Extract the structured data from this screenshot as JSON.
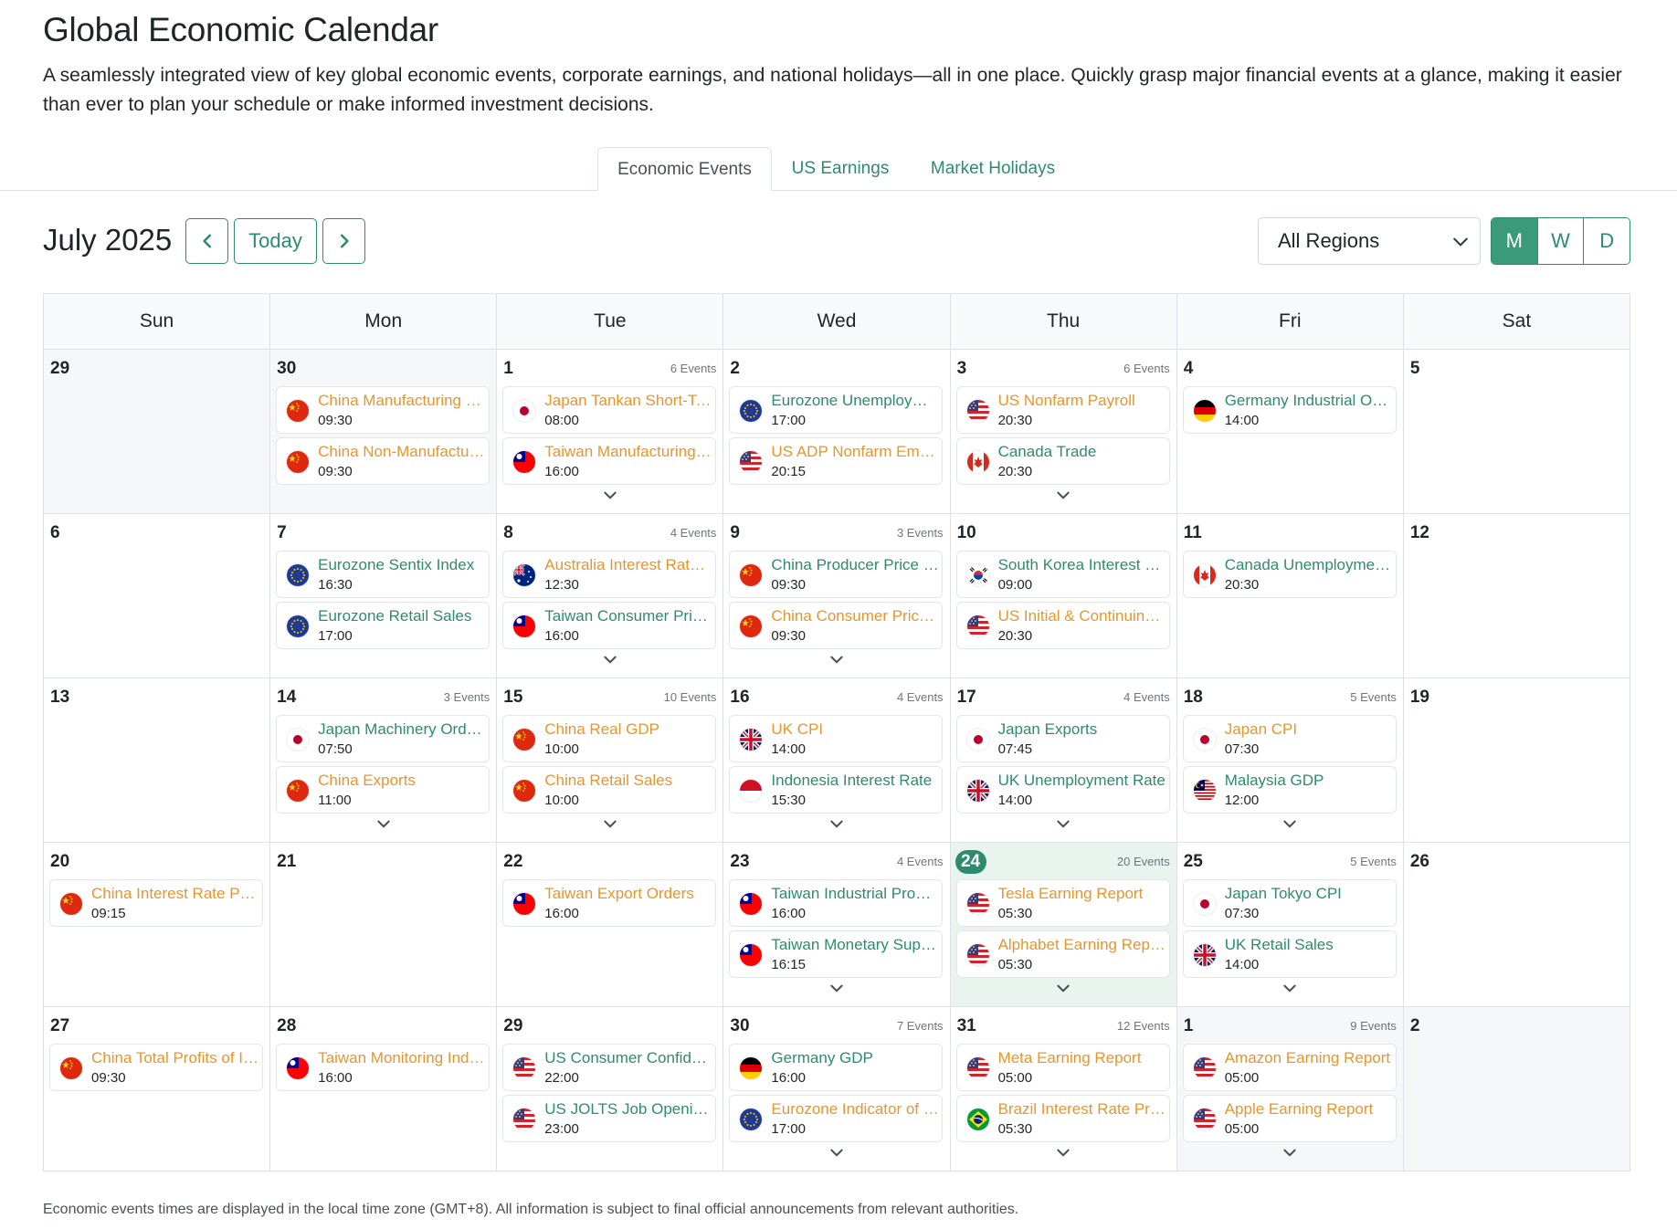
{
  "header": {
    "title": "Global Economic Calendar",
    "description": "A seamlessly integrated view of key global economic events, corporate earnings, and national holidays—all in one place. Quickly grasp major financial events at a glance, making it easier than ever to plan your schedule or make informed investment decisions."
  },
  "tabs": [
    {
      "label": "Economic Events",
      "active": true
    },
    {
      "label": "US Earnings",
      "active": false
    },
    {
      "label": "Market Holidays",
      "active": false
    }
  ],
  "toolbar": {
    "month": "July 2025",
    "today_label": "Today",
    "region": "All Regions",
    "views": [
      {
        "label": "M",
        "active": true
      },
      {
        "label": "W",
        "active": false
      },
      {
        "label": "D",
        "active": false
      }
    ]
  },
  "calendar": {
    "weekdays": [
      "Sun",
      "Mon",
      "Tue",
      "Wed",
      "Thu",
      "Fri",
      "Sat"
    ],
    "weeks": [
      [
        {
          "day": "29",
          "other": true,
          "count": "",
          "events": [],
          "more": false
        },
        {
          "day": "30",
          "other": true,
          "count": "",
          "more": false,
          "events": [
            {
              "name": "China Manufacturing PMI",
              "time": "09:30",
              "flag": "cn",
              "importance": "high"
            },
            {
              "name": "China Non-Manufacturing PMI",
              "time": "09:30",
              "flag": "cn",
              "importance": "high"
            }
          ]
        },
        {
          "day": "1",
          "other": false,
          "count": "6 Events",
          "more": true,
          "events": [
            {
              "name": "Japan Tankan Short-Term",
              "time": "08:00",
              "flag": "jp",
              "importance": "high"
            },
            {
              "name": "Taiwan Manufacturing PMI",
              "time": "16:00",
              "flag": "tw",
              "importance": "high"
            }
          ]
        },
        {
          "day": "2",
          "other": false,
          "count": "",
          "more": false,
          "events": [
            {
              "name": "Eurozone Unemployment Rate",
              "time": "17:00",
              "flag": "eu",
              "importance": "medium"
            },
            {
              "name": "US ADP Nonfarm Employment",
              "time": "20:15",
              "flag": "us",
              "importance": "high"
            }
          ]
        },
        {
          "day": "3",
          "other": false,
          "count": "6 Events",
          "more": true,
          "events": [
            {
              "name": "US Nonfarm Payroll",
              "time": "20:30",
              "flag": "us",
              "importance": "high"
            },
            {
              "name": "Canada Trade",
              "time": "20:30",
              "flag": "ca",
              "importance": "medium"
            }
          ]
        },
        {
          "day": "4",
          "other": false,
          "count": "",
          "more": false,
          "events": [
            {
              "name": "Germany Industrial Orders",
              "time": "14:00",
              "flag": "de",
              "importance": "medium"
            }
          ]
        },
        {
          "day": "5",
          "other": false,
          "count": "",
          "events": [],
          "more": false
        }
      ],
      [
        {
          "day": "6",
          "other": false,
          "count": "",
          "events": [],
          "more": false
        },
        {
          "day": "7",
          "other": false,
          "count": "",
          "more": false,
          "events": [
            {
              "name": "Eurozone Sentix Index",
              "time": "16:30",
              "flag": "eu",
              "importance": "medium"
            },
            {
              "name": "Eurozone Retail Sales",
              "time": "17:00",
              "flag": "eu",
              "importance": "medium"
            }
          ]
        },
        {
          "day": "8",
          "other": false,
          "count": "4 Events",
          "more": true,
          "events": [
            {
              "name": "Australia Interest Rate Decision",
              "time": "12:30",
              "flag": "au",
              "importance": "high"
            },
            {
              "name": "Taiwan Consumer Price Index",
              "time": "16:00",
              "flag": "tw",
              "importance": "medium"
            }
          ]
        },
        {
          "day": "9",
          "other": false,
          "count": "3 Events",
          "more": true,
          "events": [
            {
              "name": "China Producer Price Index",
              "time": "09:30",
              "flag": "cn",
              "importance": "medium"
            },
            {
              "name": "China Consumer Price Index",
              "time": "09:30",
              "flag": "cn",
              "importance": "high"
            }
          ]
        },
        {
          "day": "10",
          "other": false,
          "count": "",
          "more": false,
          "events": [
            {
              "name": "South Korea Interest Rate",
              "time": "09:00",
              "flag": "kr",
              "importance": "medium"
            },
            {
              "name": "US Initial & Continuing Claims",
              "time": "20:30",
              "flag": "us",
              "importance": "high"
            }
          ]
        },
        {
          "day": "11",
          "other": false,
          "count": "",
          "more": false,
          "events": [
            {
              "name": "Canada Unemployment Rate",
              "time": "20:30",
              "flag": "ca",
              "importance": "medium"
            }
          ]
        },
        {
          "day": "12",
          "other": false,
          "count": "",
          "events": [],
          "more": false
        }
      ],
      [
        {
          "day": "13",
          "other": false,
          "count": "",
          "events": [],
          "more": false
        },
        {
          "day": "14",
          "other": false,
          "count": "3 Events",
          "more": true,
          "events": [
            {
              "name": "Japan Machinery Orders",
              "time": "07:50",
              "flag": "jp",
              "importance": "medium"
            },
            {
              "name": "China Exports",
              "time": "11:00",
              "flag": "cn",
              "importance": "high"
            }
          ]
        },
        {
          "day": "15",
          "other": false,
          "count": "10 Events",
          "more": true,
          "events": [
            {
              "name": "China Real GDP",
              "time": "10:00",
              "flag": "cn",
              "importance": "high"
            },
            {
              "name": "China Retail Sales",
              "time": "10:00",
              "flag": "cn",
              "importance": "high"
            }
          ]
        },
        {
          "day": "16",
          "other": false,
          "count": "4 Events",
          "more": true,
          "events": [
            {
              "name": "UK CPI",
              "time": "14:00",
              "flag": "uk",
              "importance": "high"
            },
            {
              "name": "Indonesia Interest Rate",
              "time": "15:30",
              "flag": "id",
              "importance": "medium"
            }
          ]
        },
        {
          "day": "17",
          "other": false,
          "count": "4 Events",
          "more": true,
          "events": [
            {
              "name": "Japan Exports",
              "time": "07:45",
              "flag": "jp",
              "importance": "medium"
            },
            {
              "name": "UK Unemployment Rate",
              "time": "14:00",
              "flag": "uk",
              "importance": "medium"
            }
          ]
        },
        {
          "day": "18",
          "other": false,
          "count": "5 Events",
          "more": true,
          "events": [
            {
              "name": "Japan CPI",
              "time": "07:30",
              "flag": "jp",
              "importance": "high"
            },
            {
              "name": "Malaysia GDP",
              "time": "12:00",
              "flag": "my",
              "importance": "medium"
            }
          ]
        },
        {
          "day": "19",
          "other": false,
          "count": "",
          "events": [],
          "more": false
        }
      ],
      [
        {
          "day": "20",
          "other": false,
          "count": "",
          "more": false,
          "events": [
            {
              "name": "China Interest Rate Prime",
              "time": "09:15",
              "flag": "cn",
              "importance": "high"
            }
          ]
        },
        {
          "day": "21",
          "other": false,
          "count": "",
          "events": [],
          "more": false
        },
        {
          "day": "22",
          "other": false,
          "count": "",
          "more": false,
          "events": [
            {
              "name": "Taiwan Export Orders",
              "time": "16:00",
              "flag": "tw",
              "importance": "high"
            }
          ]
        },
        {
          "day": "23",
          "other": false,
          "count": "4 Events",
          "more": true,
          "events": [
            {
              "name": "Taiwan Industrial Production",
              "time": "16:00",
              "flag": "tw",
              "importance": "medium"
            },
            {
              "name": "Taiwan Monetary Supply",
              "time": "16:15",
              "flag": "tw",
              "importance": "medium"
            }
          ]
        },
        {
          "day": "24",
          "other": false,
          "today": true,
          "count": "20 Events",
          "more": true,
          "events": [
            {
              "name": "Tesla Earning Report",
              "time": "05:30",
              "flag": "us",
              "importance": "high"
            },
            {
              "name": "Alphabet Earning Report",
              "time": "05:30",
              "flag": "us",
              "importance": "high"
            }
          ]
        },
        {
          "day": "25",
          "other": false,
          "count": "5 Events",
          "more": true,
          "events": [
            {
              "name": "Japan Tokyo CPI",
              "time": "07:30",
              "flag": "jp",
              "importance": "medium"
            },
            {
              "name": "UK Retail Sales",
              "time": "14:00",
              "flag": "uk",
              "importance": "medium"
            }
          ]
        },
        {
          "day": "26",
          "other": false,
          "count": "",
          "events": [],
          "more": false
        }
      ],
      [
        {
          "day": "27",
          "other": false,
          "count": "",
          "more": false,
          "events": [
            {
              "name": "China Total Profits of Industrial",
              "time": "09:30",
              "flag": "cn",
              "importance": "high"
            }
          ]
        },
        {
          "day": "28",
          "other": false,
          "count": "",
          "more": false,
          "events": [
            {
              "name": "Taiwan Monitoring Indicator",
              "time": "16:00",
              "flag": "tw",
              "importance": "high"
            }
          ]
        },
        {
          "day": "29",
          "other": false,
          "count": "",
          "more": false,
          "events": [
            {
              "name": "US Consumer Confidence",
              "time": "22:00",
              "flag": "us",
              "importance": "medium"
            },
            {
              "name": "US JOLTS Job Openings",
              "time": "23:00",
              "flag": "us",
              "importance": "medium"
            }
          ]
        },
        {
          "day": "30",
          "other": false,
          "count": "7 Events",
          "more": true,
          "events": [
            {
              "name": "Germany GDP",
              "time": "16:00",
              "flag": "de",
              "importance": "medium"
            },
            {
              "name": "Eurozone Indicator of Economic",
              "time": "17:00",
              "flag": "eu",
              "importance": "high"
            }
          ]
        },
        {
          "day": "31",
          "other": false,
          "count": "12 Events",
          "more": true,
          "events": [
            {
              "name": "Meta Earning Report",
              "time": "05:00",
              "flag": "us",
              "importance": "high"
            },
            {
              "name": "Brazil Interest Rate Prime",
              "time": "05:30",
              "flag": "br",
              "importance": "high"
            }
          ]
        },
        {
          "day": "1",
          "other": true,
          "count": "9 Events",
          "more": true,
          "events": [
            {
              "name": "Amazon Earning Report",
              "time": "05:00",
              "flag": "us",
              "importance": "high"
            },
            {
              "name": "Apple Earning Report",
              "time": "05:00",
              "flag": "us",
              "importance": "high"
            }
          ]
        },
        {
          "day": "2",
          "other": true,
          "count": "",
          "events": [],
          "more": false
        }
      ]
    ]
  },
  "footnote": "Economic events times are displayed in the local time zone (GMT+8). All information is subject to final official announcements from relevant authorities.",
  "colors": {
    "accent": "#2e8b6e",
    "high_importance": "#e8952a",
    "today_bg": "#e9f4ef"
  }
}
